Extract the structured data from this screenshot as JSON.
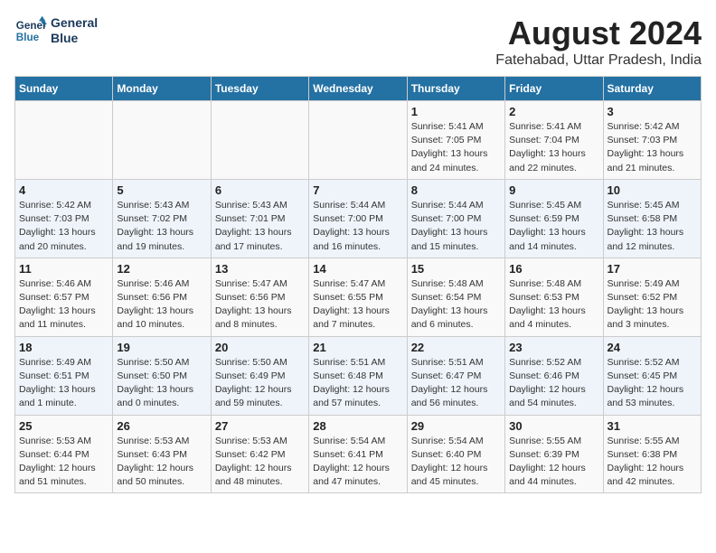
{
  "header": {
    "logo_line1": "General",
    "logo_line2": "Blue",
    "month_year": "August 2024",
    "location": "Fatehabad, Uttar Pradesh, India"
  },
  "weekdays": [
    "Sunday",
    "Monday",
    "Tuesday",
    "Wednesday",
    "Thursday",
    "Friday",
    "Saturday"
  ],
  "weeks": [
    [
      {
        "day": "",
        "info": ""
      },
      {
        "day": "",
        "info": ""
      },
      {
        "day": "",
        "info": ""
      },
      {
        "day": "",
        "info": ""
      },
      {
        "day": "1",
        "info": "Sunrise: 5:41 AM\nSunset: 7:05 PM\nDaylight: 13 hours\nand 24 minutes."
      },
      {
        "day": "2",
        "info": "Sunrise: 5:41 AM\nSunset: 7:04 PM\nDaylight: 13 hours\nand 22 minutes."
      },
      {
        "day": "3",
        "info": "Sunrise: 5:42 AM\nSunset: 7:03 PM\nDaylight: 13 hours\nand 21 minutes."
      }
    ],
    [
      {
        "day": "4",
        "info": "Sunrise: 5:42 AM\nSunset: 7:03 PM\nDaylight: 13 hours\nand 20 minutes."
      },
      {
        "day": "5",
        "info": "Sunrise: 5:43 AM\nSunset: 7:02 PM\nDaylight: 13 hours\nand 19 minutes."
      },
      {
        "day": "6",
        "info": "Sunrise: 5:43 AM\nSunset: 7:01 PM\nDaylight: 13 hours\nand 17 minutes."
      },
      {
        "day": "7",
        "info": "Sunrise: 5:44 AM\nSunset: 7:00 PM\nDaylight: 13 hours\nand 16 minutes."
      },
      {
        "day": "8",
        "info": "Sunrise: 5:44 AM\nSunset: 7:00 PM\nDaylight: 13 hours\nand 15 minutes."
      },
      {
        "day": "9",
        "info": "Sunrise: 5:45 AM\nSunset: 6:59 PM\nDaylight: 13 hours\nand 14 minutes."
      },
      {
        "day": "10",
        "info": "Sunrise: 5:45 AM\nSunset: 6:58 PM\nDaylight: 13 hours\nand 12 minutes."
      }
    ],
    [
      {
        "day": "11",
        "info": "Sunrise: 5:46 AM\nSunset: 6:57 PM\nDaylight: 13 hours\nand 11 minutes."
      },
      {
        "day": "12",
        "info": "Sunrise: 5:46 AM\nSunset: 6:56 PM\nDaylight: 13 hours\nand 10 minutes."
      },
      {
        "day": "13",
        "info": "Sunrise: 5:47 AM\nSunset: 6:56 PM\nDaylight: 13 hours\nand 8 minutes."
      },
      {
        "day": "14",
        "info": "Sunrise: 5:47 AM\nSunset: 6:55 PM\nDaylight: 13 hours\nand 7 minutes."
      },
      {
        "day": "15",
        "info": "Sunrise: 5:48 AM\nSunset: 6:54 PM\nDaylight: 13 hours\nand 6 minutes."
      },
      {
        "day": "16",
        "info": "Sunrise: 5:48 AM\nSunset: 6:53 PM\nDaylight: 13 hours\nand 4 minutes."
      },
      {
        "day": "17",
        "info": "Sunrise: 5:49 AM\nSunset: 6:52 PM\nDaylight: 13 hours\nand 3 minutes."
      }
    ],
    [
      {
        "day": "18",
        "info": "Sunrise: 5:49 AM\nSunset: 6:51 PM\nDaylight: 13 hours\nand 1 minute."
      },
      {
        "day": "19",
        "info": "Sunrise: 5:50 AM\nSunset: 6:50 PM\nDaylight: 13 hours\nand 0 minutes."
      },
      {
        "day": "20",
        "info": "Sunrise: 5:50 AM\nSunset: 6:49 PM\nDaylight: 12 hours\nand 59 minutes."
      },
      {
        "day": "21",
        "info": "Sunrise: 5:51 AM\nSunset: 6:48 PM\nDaylight: 12 hours\nand 57 minutes."
      },
      {
        "day": "22",
        "info": "Sunrise: 5:51 AM\nSunset: 6:47 PM\nDaylight: 12 hours\nand 56 minutes."
      },
      {
        "day": "23",
        "info": "Sunrise: 5:52 AM\nSunset: 6:46 PM\nDaylight: 12 hours\nand 54 minutes."
      },
      {
        "day": "24",
        "info": "Sunrise: 5:52 AM\nSunset: 6:45 PM\nDaylight: 12 hours\nand 53 minutes."
      }
    ],
    [
      {
        "day": "25",
        "info": "Sunrise: 5:53 AM\nSunset: 6:44 PM\nDaylight: 12 hours\nand 51 minutes."
      },
      {
        "day": "26",
        "info": "Sunrise: 5:53 AM\nSunset: 6:43 PM\nDaylight: 12 hours\nand 50 minutes."
      },
      {
        "day": "27",
        "info": "Sunrise: 5:53 AM\nSunset: 6:42 PM\nDaylight: 12 hours\nand 48 minutes."
      },
      {
        "day": "28",
        "info": "Sunrise: 5:54 AM\nSunset: 6:41 PM\nDaylight: 12 hours\nand 47 minutes."
      },
      {
        "day": "29",
        "info": "Sunrise: 5:54 AM\nSunset: 6:40 PM\nDaylight: 12 hours\nand 45 minutes."
      },
      {
        "day": "30",
        "info": "Sunrise: 5:55 AM\nSunset: 6:39 PM\nDaylight: 12 hours\nand 44 minutes."
      },
      {
        "day": "31",
        "info": "Sunrise: 5:55 AM\nSunset: 6:38 PM\nDaylight: 12 hours\nand 42 minutes."
      }
    ]
  ]
}
